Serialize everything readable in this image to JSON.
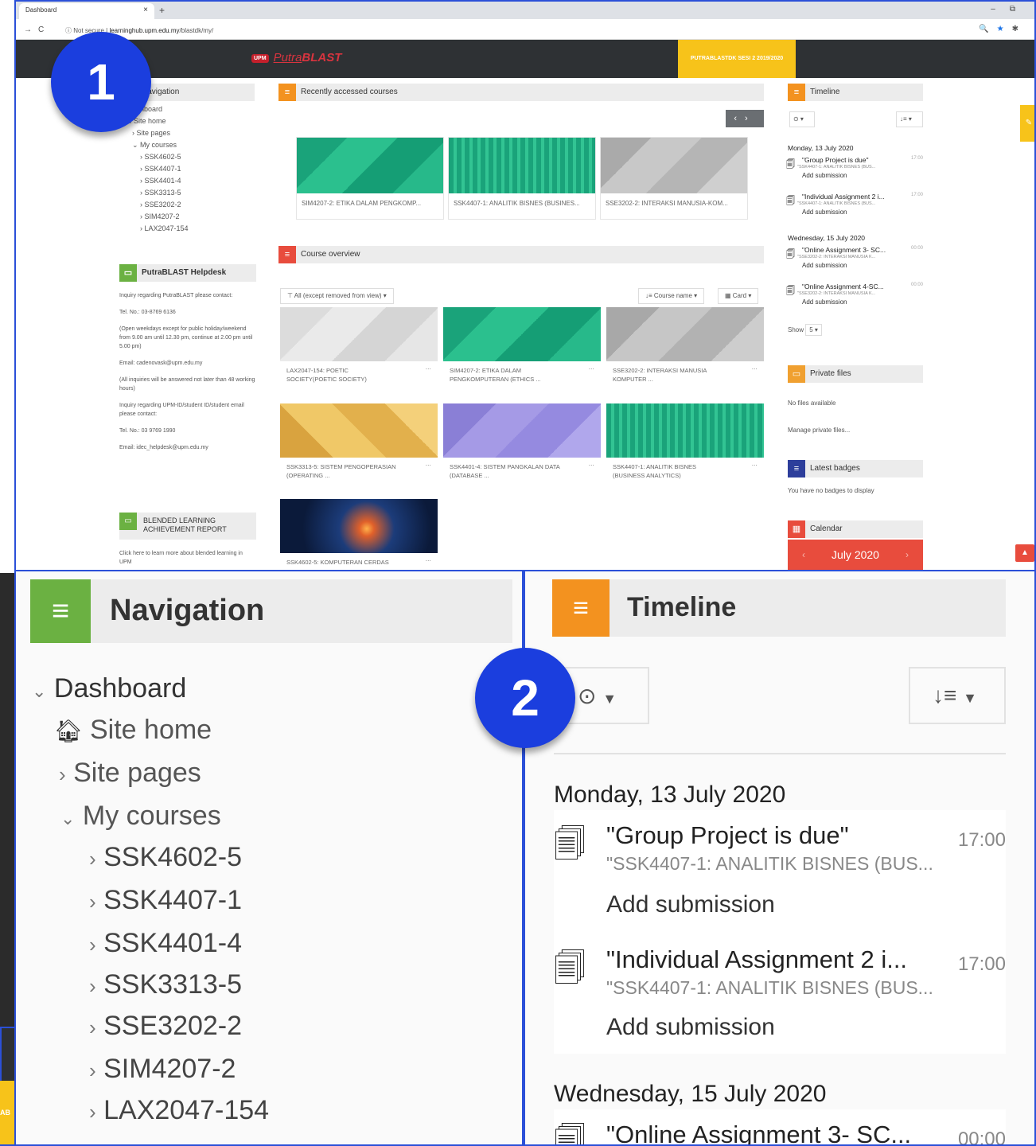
{
  "browser": {
    "tab_title": "Dashboard",
    "new_tab": "+",
    "security_text": "Not secure",
    "url_host": "learninghub.upm.edu.my",
    "url_path": "/blastdk/my/"
  },
  "site": {
    "logo_badge": "UPM",
    "logo_putra": "Putra",
    "logo_blast": "BLAST",
    "session_button": "PUTRABLASTDK SESI 2 2019/2020"
  },
  "navigation_block": {
    "title": "Navigation",
    "items": [
      "Dashboard",
      "Site home",
      "Site pages",
      "My courses",
      "SSK4602-5",
      "SSK4407-1",
      "SSK4401-4",
      "SSK3313-5",
      "SSE3202-2",
      "SIM4207-2",
      "LAX2047-154"
    ]
  },
  "helpdesk": {
    "title": "PutraBLAST Helpdesk",
    "l1": "Inquiry regarding PutraBLAST please contact:",
    "l2": "Tel. No.: 03-8769 6136",
    "l3": "(Open weekdays except for public holiday/weekend from 9.00 am until 12.30 pm, continue at 2.00 pm until 5.00 pm)",
    "l4": "Email: cadenovask@upm.edu.my",
    "l5": "(All inquiries will be answered not later than 48 working hours)",
    "l6": "Inquiry regarding UPM-ID/student ID/student email please contact:",
    "l7": "Tel. No.: 03 9769 1990",
    "l8": "Email: idec_helpdesk@upm.edu.my"
  },
  "blended": {
    "title_l1": "BLENDED LEARNING",
    "title_l2": "ACHIEVEMENT REPORT",
    "text": "Click here to learn more about blended learning in UPM"
  },
  "recent": {
    "title": "Recently accessed courses",
    "cards": [
      "SIM4207-2: ETIKA DALAM PENGKOMP...",
      "SSK4407-1: ANALITIK BISNES (BUSINES...",
      "SSE3202-2: INTERAKSI MANUSIA-KOM..."
    ]
  },
  "overview": {
    "title": "Course overview",
    "filter": "All (except removed from view)",
    "sort": "Course name",
    "view": "Card",
    "cards": [
      {
        "l1": "LAX2047-154: POETIC",
        "l2": "SOCIETY(POETIC SOCIETY)"
      },
      {
        "l1": "SIM4207-2: ETIKA DALAM",
        "l2": "PENGKOMPUTERAN (ETHICS ..."
      },
      {
        "l1": "SSE3202-2: INTERAKSI MANUSIA",
        "l2": "KOMPUTER ..."
      },
      {
        "l1": "SSK3313-5: SISTEM PENGOPERASIAN",
        "l2": "(OPERATING ..."
      },
      {
        "l1": "SSK4401-4: SISTEM PANGKALAN DATA",
        "l2": "(DATABASE ..."
      },
      {
        "l1": "SSK4407-1: ANALITIK BISNES",
        "l2": "(BUSINESS ANALYTICS)"
      },
      {
        "l1": "SSK4602-5: KOMPUTERAN CERDAS",
        "l2": ""
      }
    ],
    "more": "…"
  },
  "timeline": {
    "title": "Timeline",
    "day1": "Monday, 13 July 2020",
    "day2": "Wednesday, 15 July 2020",
    "items": [
      {
        "title": "\"Group Project is due\"",
        "course": "\"SSK4407-1: ANALITIK BISNES (BUS...",
        "time": "17:00",
        "action": "Add submission"
      },
      {
        "title": "\"Individual Assignment 2 i...",
        "course": "\"SSK4407-1: ANALITIK BISNES (BUS...",
        "time": "17:00",
        "action": "Add submission"
      },
      {
        "title": "\"Online Assignment 3- SC...",
        "course": "\"SSE3202-2: INTERAKSI MANUSIA K...",
        "time": "00:00",
        "action": "Add submission"
      },
      {
        "title": "\"Online Assignment 4-SC...",
        "course": "\"SSE3202-2: INTERAKSI MANUSIA K...",
        "time": "00:00",
        "action": "Add submission"
      }
    ],
    "show_label": "Show",
    "show_value": "5"
  },
  "private_files": {
    "title": "Private files",
    "empty": "No files available",
    "manage": "Manage private files..."
  },
  "badges": {
    "title": "Latest badges",
    "empty": "You have no badges to display"
  },
  "calendar": {
    "title": "Calendar",
    "month": "July 2020"
  },
  "callouts": {
    "one": "1",
    "two": "2"
  },
  "colors": {
    "accent_blue": "#1b3ede",
    "orange": "#f3921f",
    "green": "#6bb142",
    "red": "#e84c3d",
    "yellow": "#f7c31a"
  }
}
